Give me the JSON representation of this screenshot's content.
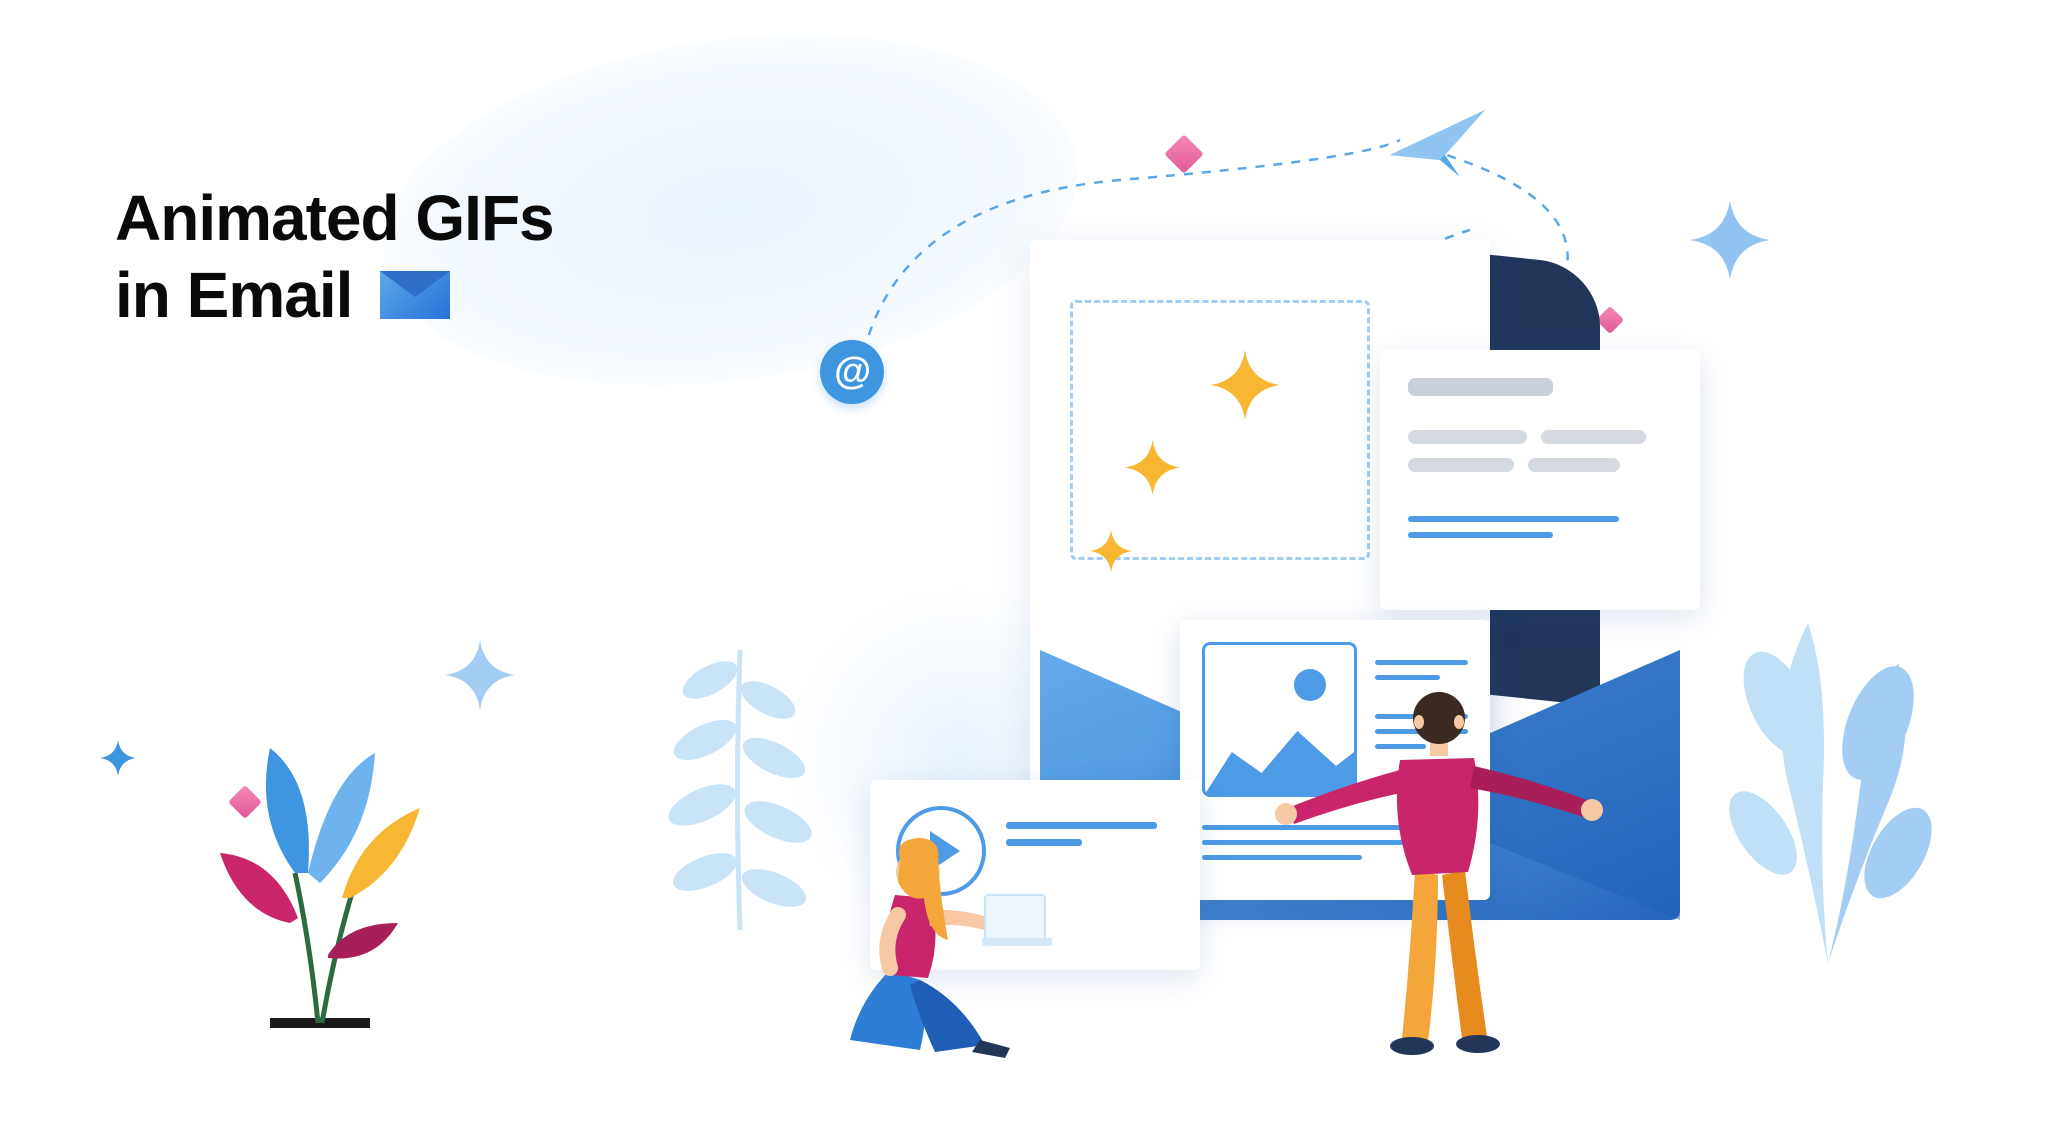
{
  "heading": {
    "line1": "Animated GIFs",
    "line2": "in Email"
  },
  "at_symbol": "@",
  "colors": {
    "primary_blue": "#4d9be6",
    "dark_blue": "#22365a",
    "gold": "#f7b733",
    "magenta": "#c9256b",
    "pale_blue": "#a3cdf2"
  }
}
